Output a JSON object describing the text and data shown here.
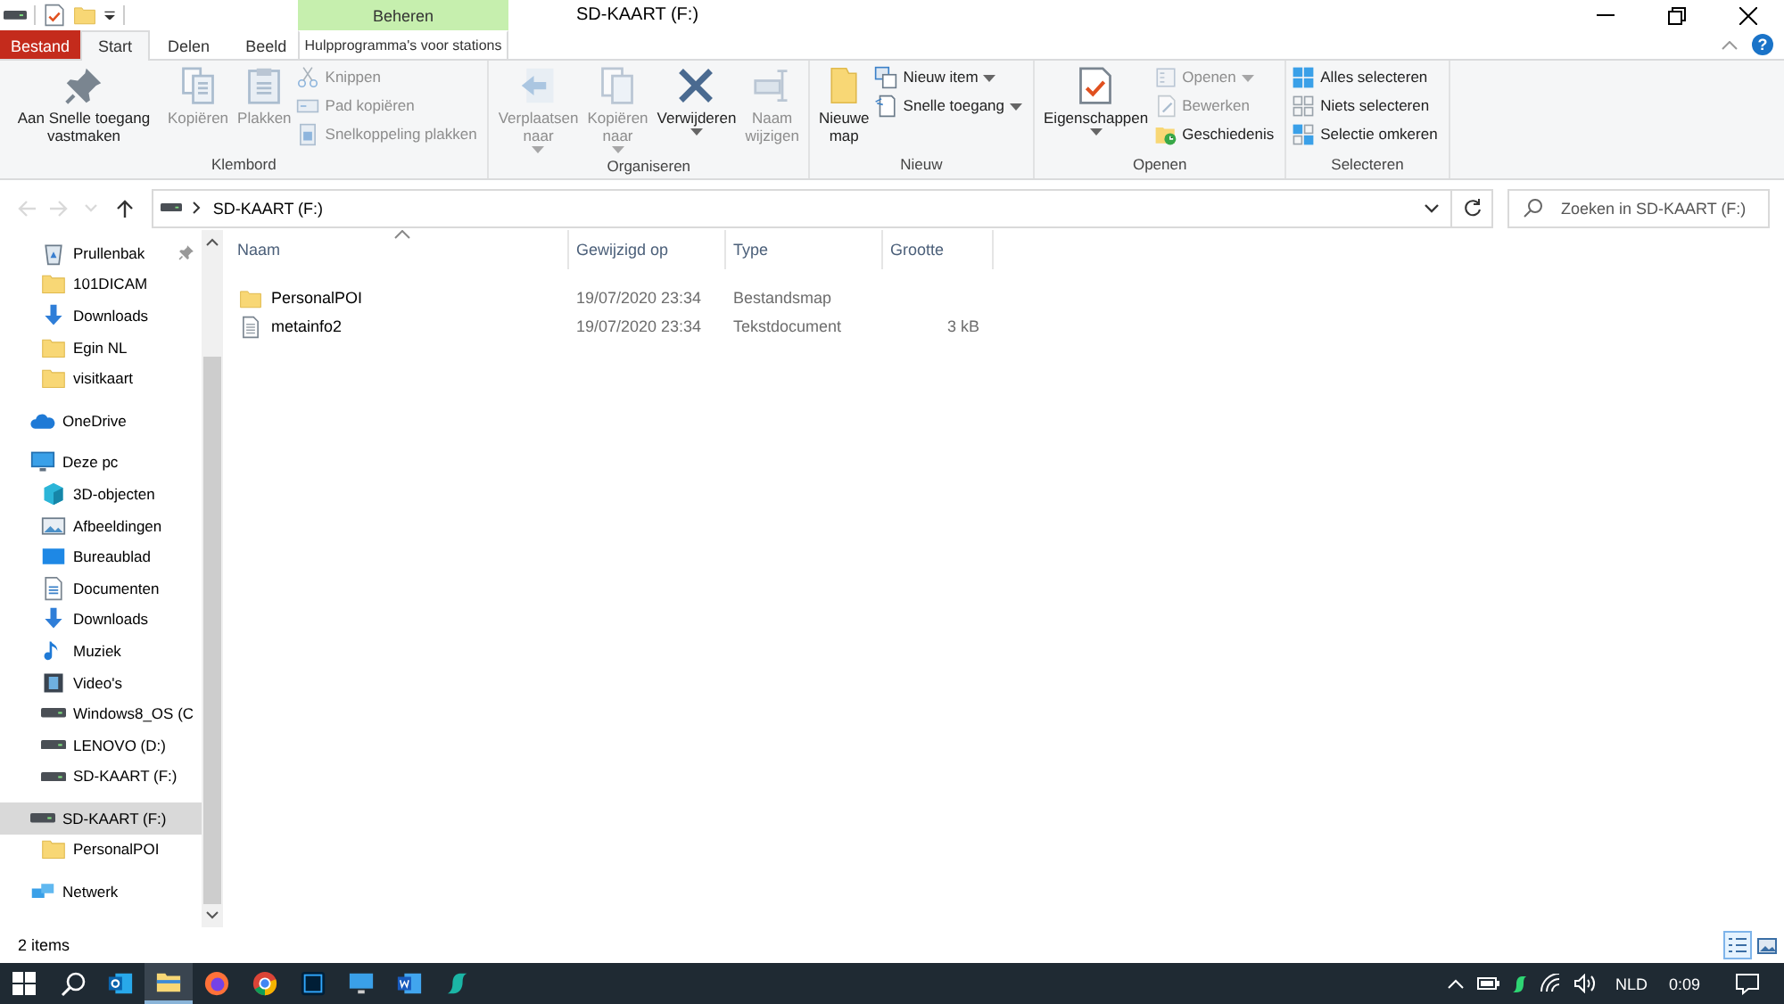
{
  "window": {
    "title": "SD-KAART (F:)",
    "context_group": "Beheren",
    "help_label": "?"
  },
  "quick_access_toolbar": [
    {
      "kind": "drive"
    },
    {
      "kind": "properties"
    },
    {
      "kind": "folder"
    },
    {
      "kind": "menu"
    }
  ],
  "tabs": [
    {
      "label": "Bestand",
      "kind": "file",
      "selected": false
    },
    {
      "label": "Start",
      "kind": "tab",
      "selected": true
    },
    {
      "label": "Delen",
      "kind": "tab",
      "selected": false
    },
    {
      "label": "Beeld",
      "kind": "tab",
      "selected": false
    },
    {
      "label": "Hulpprogramma's voor stations",
      "kind": "context",
      "selected": false
    }
  ],
  "ribbon": [
    {
      "label": "Klembord",
      "large": [
        {
          "label": "Aan Snelle toegang vastmaken",
          "kind": "pin",
          "disabled": false,
          "menu": false
        },
        {
          "label": "Kopiëren",
          "kind": "copy",
          "disabled": true,
          "menu": false
        },
        {
          "label": "Plakken",
          "kind": "paste",
          "disabled": true,
          "menu": false
        }
      ],
      "small": [
        {
          "label": "Knippen",
          "kind": "cut",
          "disabled": true,
          "menu": false
        },
        {
          "label": "Pad kopiëren",
          "kind": "path",
          "disabled": true,
          "menu": false
        },
        {
          "label": "Snelkoppeling plakken",
          "kind": "shortcut",
          "disabled": true,
          "menu": false
        }
      ]
    },
    {
      "label": "Organiseren",
      "large": [
        {
          "label": "Verplaatsen naar",
          "kind": "move",
          "disabled": true,
          "menu": true
        },
        {
          "label": "Kopiëren naar",
          "kind": "copyto",
          "disabled": true,
          "menu": true
        },
        {
          "label": "Verwijderen",
          "kind": "delete",
          "disabled": false,
          "menu": true
        },
        {
          "label": "Naam wijzigen",
          "kind": "rename",
          "disabled": true,
          "menu": false
        }
      ]
    },
    {
      "label": "Nieuw",
      "large": [
        {
          "label": "Nieuwe map",
          "kind": "newfolder",
          "disabled": false,
          "menu": false
        }
      ],
      "small": [
        {
          "label": "Nieuw item",
          "kind": "newitem",
          "disabled": false,
          "menu": true
        },
        {
          "label": "Snelle toegang",
          "kind": "quickaccess",
          "disabled": false,
          "menu": true
        }
      ]
    },
    {
      "label": "Openen",
      "large": [
        {
          "label": "Eigenschappen",
          "kind": "properties",
          "disabled": false,
          "menu": true
        }
      ],
      "small": [
        {
          "label": "Openen",
          "kind": "open",
          "disabled": true,
          "menu": true
        },
        {
          "label": "Bewerken",
          "kind": "edit",
          "disabled": true,
          "menu": false
        },
        {
          "label": "Geschiedenis",
          "kind": "history",
          "disabled": false,
          "menu": false
        }
      ]
    },
    {
      "label": "Selecteren",
      "small": [
        {
          "label": "Alles selecteren",
          "kind": "selectall",
          "disabled": false,
          "menu": false
        },
        {
          "label": "Niets selecteren",
          "kind": "selectnone",
          "disabled": false,
          "menu": false
        },
        {
          "label": "Selectie omkeren",
          "kind": "invert",
          "disabled": false,
          "menu": false
        }
      ]
    }
  ],
  "address_bar": {
    "back_disabled": true,
    "forward_disabled": true,
    "path": "SD-KAART (F:)",
    "search_placeholder": "Zoeken in SD-KAART (F:)"
  },
  "navigation": {
    "pinned_items": [
      {
        "label": "Prullenbak",
        "kind": "recycle",
        "pinned": true,
        "selected": false
      },
      {
        "label": "101DICAM",
        "kind": "folder",
        "pinned": false,
        "selected": false
      },
      {
        "label": "Downloads",
        "kind": "download",
        "pinned": false,
        "selected": false
      },
      {
        "label": "Egin NL",
        "kind": "folder",
        "pinned": false,
        "selected": false
      },
      {
        "label": "visitkaart",
        "kind": "folder",
        "pinned": false,
        "selected": false
      }
    ],
    "items": [
      {
        "label": "OneDrive",
        "kind": "cloud",
        "selected": false
      },
      {
        "label": "Deze pc",
        "kind": "pc",
        "selected": false,
        "children": [
          {
            "label": "3D-objecten",
            "kind": "cube",
            "selected": false
          },
          {
            "label": "Afbeeldingen",
            "kind": "pictures",
            "selected": false
          },
          {
            "label": "Bureaublad",
            "kind": "desktop",
            "selected": false
          },
          {
            "label": "Documenten",
            "kind": "document",
            "selected": false
          },
          {
            "label": "Downloads",
            "kind": "download",
            "selected": false
          },
          {
            "label": "Muziek",
            "kind": "music",
            "selected": false
          },
          {
            "label": "Video's",
            "kind": "video",
            "selected": false
          },
          {
            "label": "Windows8_OS (C",
            "kind": "drive",
            "selected": false
          },
          {
            "label": "LENOVO (D:)",
            "kind": "drive",
            "selected": false
          },
          {
            "label": "SD-KAART (F:)",
            "kind": "drive",
            "selected": false
          }
        ]
      },
      {
        "label": "SD-KAART (F:)",
        "kind": "drive",
        "selected": true,
        "children": [
          {
            "label": "PersonalPOI",
            "kind": "folder",
            "selected": false
          }
        ]
      },
      {
        "label": "Netwerk",
        "kind": "network",
        "selected": false
      }
    ]
  },
  "files": {
    "columns": [
      {
        "label": "Naam",
        "sorted": true
      },
      {
        "label": "Gewijzigd op",
        "sorted": false
      },
      {
        "label": "Type",
        "sorted": false
      },
      {
        "label": "Grootte",
        "sorted": false
      }
    ],
    "rows": [
      {
        "kind": "folder",
        "name": "PersonalPOI",
        "modified": "19/07/2020 23:34",
        "type": "Bestandsmap",
        "selected": false
      },
      {
        "kind": "text",
        "name": "metainfo2",
        "modified": "19/07/2020 23:34",
        "type": "Tekstdocument",
        "size": "3 kB",
        "selected": false
      }
    ]
  },
  "status_bar": {
    "count": "2 items",
    "views": [
      {
        "kind": "details",
        "selected": true
      },
      {
        "kind": "large",
        "selected": false
      }
    ]
  },
  "taskbar": {
    "apps": [
      {
        "kind": "outlook",
        "selected": false
      },
      {
        "kind": "explorer",
        "selected": true
      },
      {
        "kind": "firefox",
        "selected": false
      },
      {
        "kind": "chrome",
        "selected": false
      },
      {
        "kind": "photoshop",
        "selected": false
      },
      {
        "kind": "monitor",
        "selected": false
      },
      {
        "kind": "word",
        "selected": false
      },
      {
        "kind": "sapp",
        "selected": false
      }
    ],
    "language": "NLD",
    "time": "0:09"
  }
}
